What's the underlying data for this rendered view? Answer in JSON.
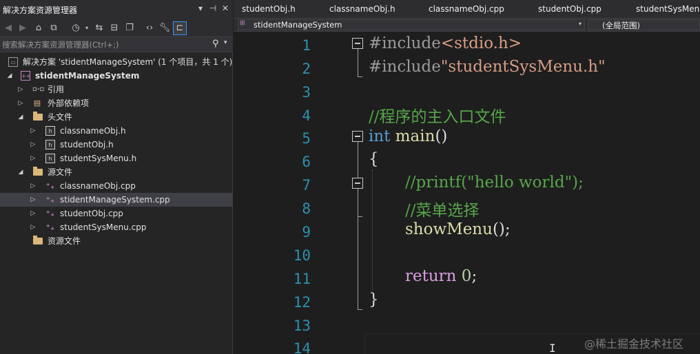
{
  "solution_explorer": {
    "title": "解决方案资源管理器",
    "title_buttons": [
      "▾",
      "⊣",
      "✕"
    ],
    "toolbar_icons": [
      "back-icon",
      "forward-icon",
      "home-icon",
      "vs-switch-icon",
      "history-icon",
      "sync-icon",
      "collapse-all-icon",
      "copy-icon",
      "code-view-icon",
      "wrench-icon",
      "preview-icon"
    ],
    "search_placeholder": "搜索解决方案资源管理器(Ctrl+;)",
    "solution_label": "解决方案 'stidentManageSystem' (1 个项目，共 1 个)",
    "project_label": "stidentManageSystem",
    "items": {
      "references": "引用",
      "external_deps": "外部依赖项",
      "header_folder": "头文件",
      "header_files": [
        "classnameObj.h",
        "studentObj.h",
        "studentSysMenu.h"
      ],
      "source_folder": "源文件",
      "source_files": [
        "classnameObj.cpp",
        "stidentManageSystem.cpp",
        "studentObj.cpp",
        "studentSysMenu.cpp"
      ],
      "resource_folder": "资源文件"
    }
  },
  "tabs": [
    "studentObj.h",
    "classnameObj.h",
    "classnameObj.cpp",
    "studentObj.cpp",
    "studentSysMenu.h"
  ],
  "navbar": {
    "project_scope": "stidentManageSystem",
    "member_scope": "(全局范围)"
  },
  "editor": {
    "line_numbers": [
      "1",
      "2",
      "3",
      "4",
      "5",
      "6",
      "7",
      "8",
      "9",
      "10",
      "11",
      "12",
      "13",
      "14"
    ],
    "code": {
      "l1_kw": "#include",
      "l1_str": "<stdio.h>",
      "l2_kw": "#include",
      "l2_str": "\"studentSysMenu.h\"",
      "l4": "//程序的主入口文件",
      "l5_kw": "int",
      "l5_fn": "main",
      "l5_paren": "()",
      "l6": "{",
      "l7": "//printf(\"hello world\");",
      "l8": "//菜单选择",
      "l9_fn": "showMenu",
      "l9_rest": "();",
      "l11_kw": "return",
      "l11_num": "0",
      "l11_semi": ";",
      "l12": "}"
    }
  },
  "watermark": "@稀土掘金技术社区",
  "colors": {
    "background": "#1e1e1e",
    "panel": "#252526",
    "line_number": "#2b91af",
    "keyword": "#569cd6",
    "string": "#d69d85",
    "comment": "#57a64a",
    "function": "#dcdcaa",
    "control": "#d8a0df"
  }
}
